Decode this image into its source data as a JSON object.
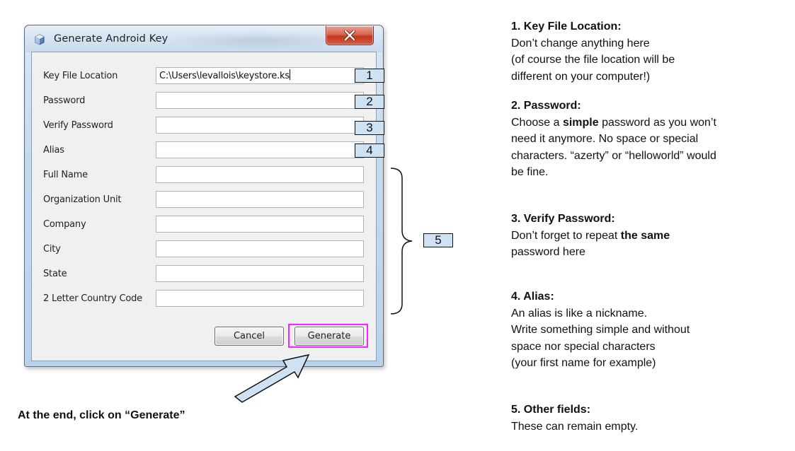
{
  "dialog": {
    "title": "Generate Android Key",
    "icon": "app-cube-icon",
    "close_icon": "close-icon",
    "fields": [
      {
        "label": "Key File Location",
        "value": "C:\\Users\\levallois\\keystore.ks"
      },
      {
        "label": "Password",
        "value": ""
      },
      {
        "label": "Verify Password",
        "value": ""
      },
      {
        "label": "Alias",
        "value": ""
      },
      {
        "label": "Full Name",
        "value": ""
      },
      {
        "label": "Organization Unit",
        "value": ""
      },
      {
        "label": "Company",
        "value": ""
      },
      {
        "label": "City",
        "value": ""
      },
      {
        "label": "State",
        "value": ""
      },
      {
        "label": "2 Letter Country Code",
        "value": ""
      }
    ],
    "buttons": {
      "cancel": "Cancel",
      "generate": "Generate"
    }
  },
  "annotations": {
    "callouts": [
      "1",
      "2",
      "3",
      "4",
      "5"
    ],
    "highlight_color": "#ff20ff",
    "callout_fill": "#cfe2f3",
    "instruction": "At the end, click on “Generate”"
  },
  "notes": [
    {
      "heading": "1. Key File Location:",
      "lines": [
        "Don’t change anything here",
        "(of course the file location will be",
        "different on your computer!)"
      ]
    },
    {
      "heading": "2. Password:",
      "parts": {
        "pre": "Choose a ",
        "bold": "simple",
        "post": " password as you won’t",
        "rest": [
          "need it anymore. No space or special",
          "characters. “azerty” or “helloworld” would",
          "be fine."
        ]
      }
    },
    {
      "heading": "3. Verify Password:",
      "parts": {
        "pre": "Don’t forget to repeat ",
        "bold": "the same",
        "rest": [
          "password here"
        ]
      }
    },
    {
      "heading": "4. Alias:",
      "lines": [
        "An alias is like a nickname.",
        "Write something simple and without",
        "space nor special characters",
        "(your first name for example)"
      ]
    },
    {
      "heading": "5. Other fields:",
      "lines": [
        "These can remain empty."
      ]
    }
  ]
}
